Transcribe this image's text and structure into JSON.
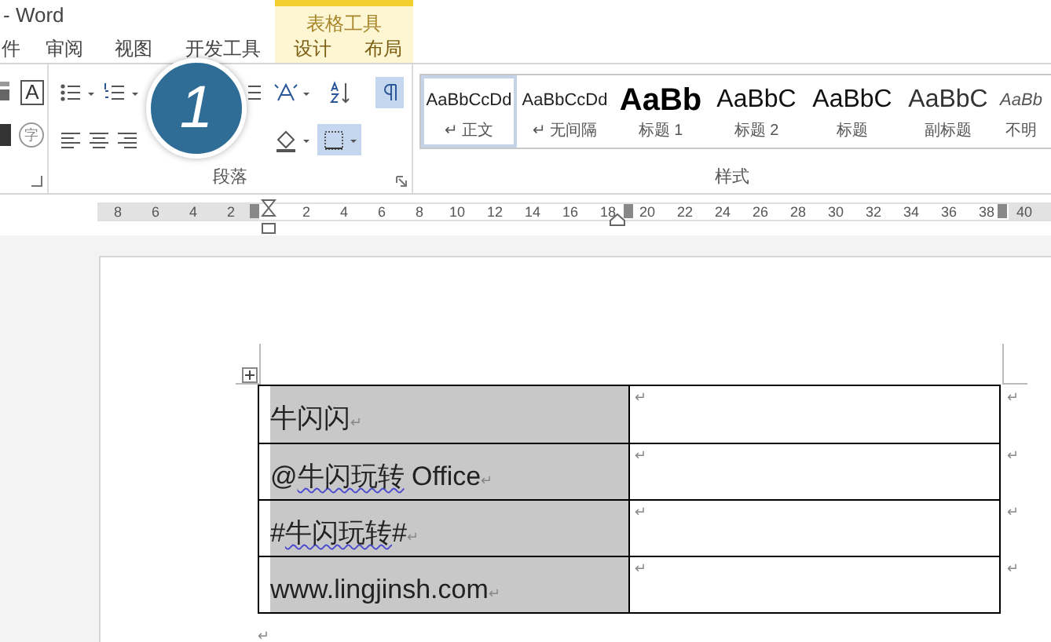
{
  "window": {
    "title": "- Word"
  },
  "contextual_group": {
    "label": "表格工具"
  },
  "tabs": [
    {
      "label": "件",
      "selected": false,
      "contextual": false
    },
    {
      "label": "审阅",
      "selected": false,
      "contextual": false
    },
    {
      "label": "视图",
      "selected": false,
      "contextual": false
    },
    {
      "label": "开发工具",
      "selected": false,
      "contextual": false
    },
    {
      "label": "设计",
      "selected": false,
      "contextual": true
    },
    {
      "label": "布局",
      "selected": false,
      "contextual": true
    }
  ],
  "font_group": {
    "boxed_letter": "A",
    "circled_char": "字"
  },
  "paragraph_group": {
    "label": "段落",
    "tools": [
      {
        "kind": "bullets",
        "selected": false
      },
      {
        "kind": "numbering",
        "selected": false
      },
      {
        "kind": "lines",
        "selected": false
      },
      {
        "kind": "chinese-layout",
        "selected": false
      },
      {
        "kind": "sort",
        "selected": false
      },
      {
        "kind": "marks",
        "selected": true
      },
      {
        "kind": "align-left",
        "selected": false
      },
      {
        "kind": "align-center",
        "selected": false
      },
      {
        "kind": "align-right",
        "selected": false
      },
      {
        "kind": "shading",
        "selected": false
      },
      {
        "kind": "borders",
        "selected": true
      }
    ]
  },
  "step_badge": "1",
  "styles_group": {
    "label": "样式",
    "styles": [
      {
        "sample": "AaBbCcDd",
        "name": "↵ 正文",
        "kind": "normal",
        "selected": true
      },
      {
        "sample": "AaBbCcDd",
        "name": "↵ 无间隔",
        "kind": "normal",
        "selected": false
      },
      {
        "sample": "AaBb",
        "name": "标题 1",
        "kind": "heading1",
        "selected": false
      },
      {
        "sample": "AaBbC",
        "name": "标题 2",
        "kind": "heading2",
        "selected": false
      },
      {
        "sample": "AaBbC",
        "name": "标题",
        "kind": "title",
        "selected": false
      },
      {
        "sample": "AaBbC",
        "name": "副标题",
        "kind": "subtitle",
        "selected": false
      },
      {
        "sample": "AaBb",
        "name": "不明",
        "kind": "emphasis",
        "selected": false
      }
    ]
  },
  "ruler": {
    "left_numbers": [
      "8",
      "6",
      "4",
      "2"
    ],
    "right_numbers": [
      "2",
      "4",
      "6",
      "8",
      "10",
      "12",
      "14",
      "16",
      "18",
      "20",
      "22",
      "24",
      "26",
      "28",
      "30",
      "32",
      "34",
      "36",
      "38",
      "40"
    ]
  },
  "table": {
    "rows": [
      {
        "cell_1": {
          "segments": [
            {
              "text": "牛闪闪",
              "misspelled": false
            }
          ],
          "mark": "↵"
        },
        "cell_2": {
          "mark": "↵"
        },
        "row_end": "↵"
      },
      {
        "cell_1": {
          "segments": [
            {
              "text": "@",
              "misspelled": false
            },
            {
              "text": "牛闪玩转",
              "misspelled": true
            },
            {
              "text": " Office",
              "misspelled": false
            }
          ],
          "mark": "↵"
        },
        "cell_2": {
          "mark": "↵"
        },
        "row_end": "↵"
      },
      {
        "cell_1": {
          "segments": [
            {
              "text": "#",
              "misspelled": false
            },
            {
              "text": "牛闪玩转",
              "misspelled": true
            },
            {
              "text": "#",
              "misspelled": false
            }
          ],
          "mark": "↵"
        },
        "cell_2": {
          "mark": "↵"
        },
        "row_end": "↵"
      },
      {
        "cell_1": {
          "segments": [
            {
              "text": "www.lingjinsh.com",
              "misspelled": false
            }
          ],
          "mark": "↵"
        },
        "cell_2": {
          "mark": "↵"
        },
        "row_end": "↵"
      }
    ],
    "after_mark": "↵"
  }
}
